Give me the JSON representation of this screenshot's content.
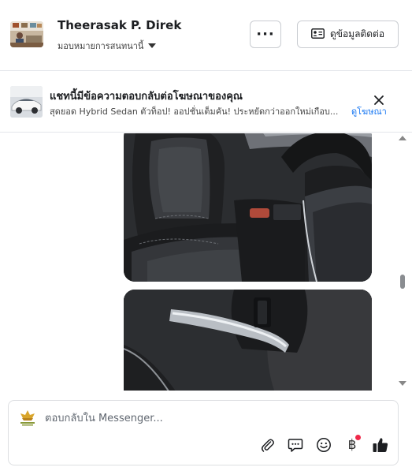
{
  "header": {
    "contact_name": "Theerasak P. Direk",
    "assignment_label": "มอบหมายการสนทนานี้",
    "more_label": "···",
    "contact_info_label": "ดูข้อมูลติดต่อ"
  },
  "ad_banner": {
    "title": "แชทนี้มีข้อความตอบกลับต่อโฆษณาของคุณ",
    "description": "สุดยอด Hybrid Sedan ตัวท็อป! ออปชั่นเต็มคัน! ประหยัดกว่าออกใหม่เกือบ...",
    "view_ad_label": "ดูโฆษณา"
  },
  "composer": {
    "placeholder": "ตอบกลับใน Messenger...",
    "currency_symbol": "฿"
  },
  "icons": {
    "more": "more-dots-icon",
    "contact": "contact-card-icon",
    "close": "close-icon",
    "attach": "paperclip-icon",
    "saved_replies": "chat-bubble-icon",
    "emoji": "emoji-icon",
    "payment": "baht-icon",
    "like": "thumbs-up-icon"
  },
  "colors": {
    "link": "#1877f2",
    "like": "#1877f2",
    "notification_dot": "#f02849"
  }
}
